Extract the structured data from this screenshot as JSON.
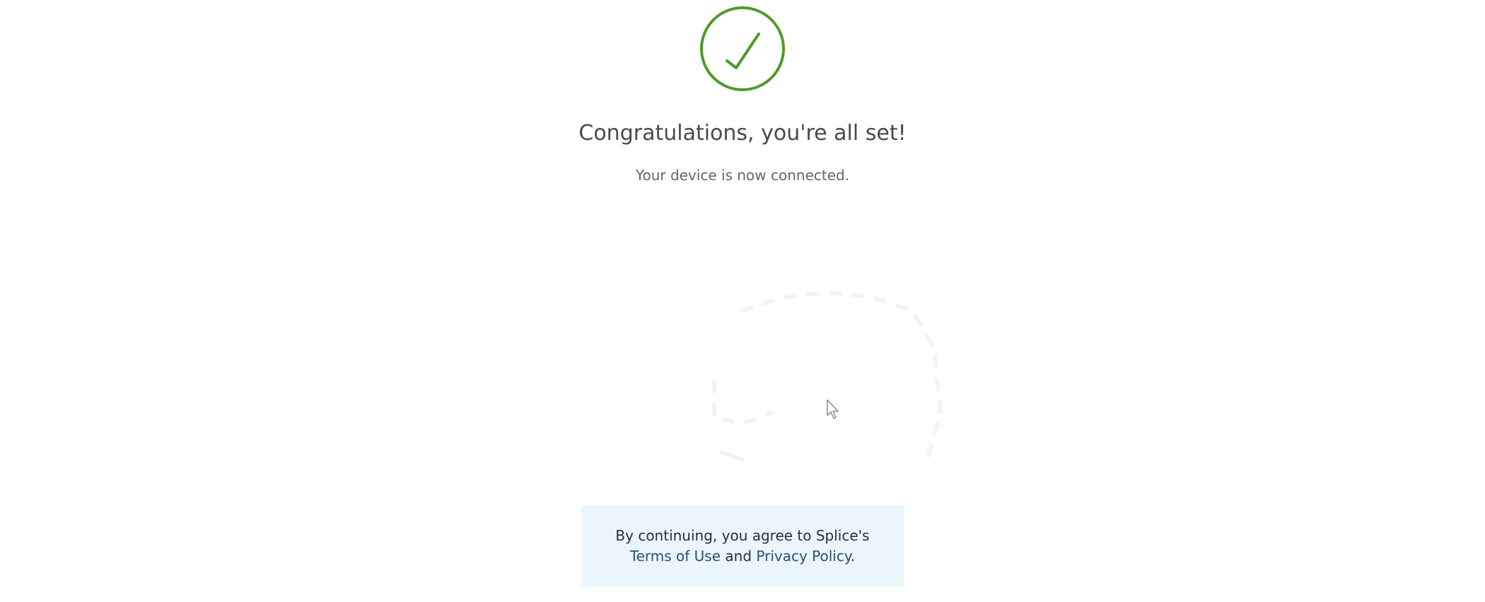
{
  "confirmation": {
    "icon": "check-circle-icon",
    "title": "Congratulations, you're all set!",
    "subtitle": "Your device is now connected."
  },
  "consent": {
    "prefix": "By continuing, you agree to Splice's",
    "terms_link": "Terms of Use",
    "and_text": " and ",
    "privacy_link": "Privacy Policy",
    "suffix": "."
  },
  "colors": {
    "success_green": "#4e9a2c",
    "consent_background": "#eaf6fc",
    "link": "#2c5070"
  }
}
